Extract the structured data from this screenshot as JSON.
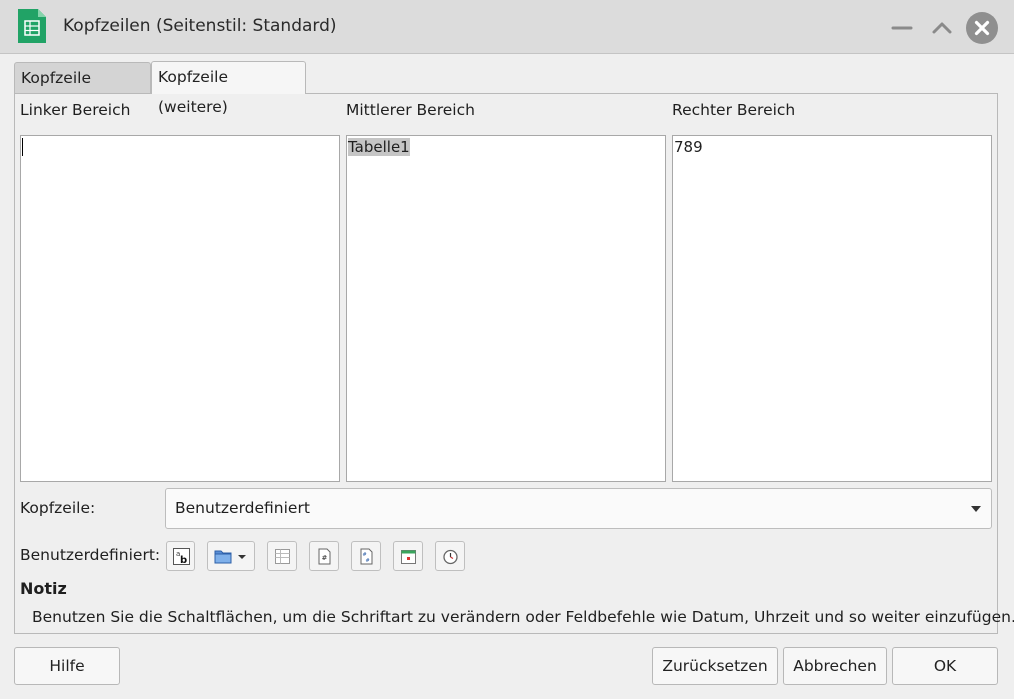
{
  "window": {
    "title": "Kopfzeilen (Seitenstil: Standard)",
    "app_icon": "spreadsheet-icon",
    "controls": [
      "minimize-icon",
      "maximize-icon",
      "close-icon"
    ]
  },
  "tabs": [
    {
      "label": "Kopfzeile (erste)",
      "active": false
    },
    {
      "label": "Kopfzeile (weitere)",
      "active": true
    }
  ],
  "areas": {
    "left": {
      "label": "Linker Bereich",
      "content": ""
    },
    "center": {
      "label": "Mittlerer Bereich",
      "content": "Tabelle1"
    },
    "right": {
      "label": "Rechter Bereich",
      "content": "789"
    }
  },
  "header_select": {
    "label": "Kopfzeile:",
    "value": "Benutzerdefiniert"
  },
  "custom": {
    "label": "Benutzerdefiniert:",
    "buttons": [
      "text-attributes-icon",
      "file-name-icon",
      "sheet-name-icon",
      "page-number-icon",
      "page-count-icon",
      "date-icon",
      "time-icon"
    ]
  },
  "note": {
    "title": "Notiz",
    "text": "Benutzen Sie die Schaltflächen, um die Schriftart zu verändern oder Feldbefehle wie Datum, Uhrzeit und so weiter einzufügen."
  },
  "footer": {
    "help": "Hilfe",
    "reset": "Zurücksetzen",
    "cancel": "Abbrechen",
    "ok": "OK"
  },
  "colors": {
    "app_icon": "#21a366",
    "titlebar": "#dcdcdc",
    "selection": "#c5c5c5"
  }
}
